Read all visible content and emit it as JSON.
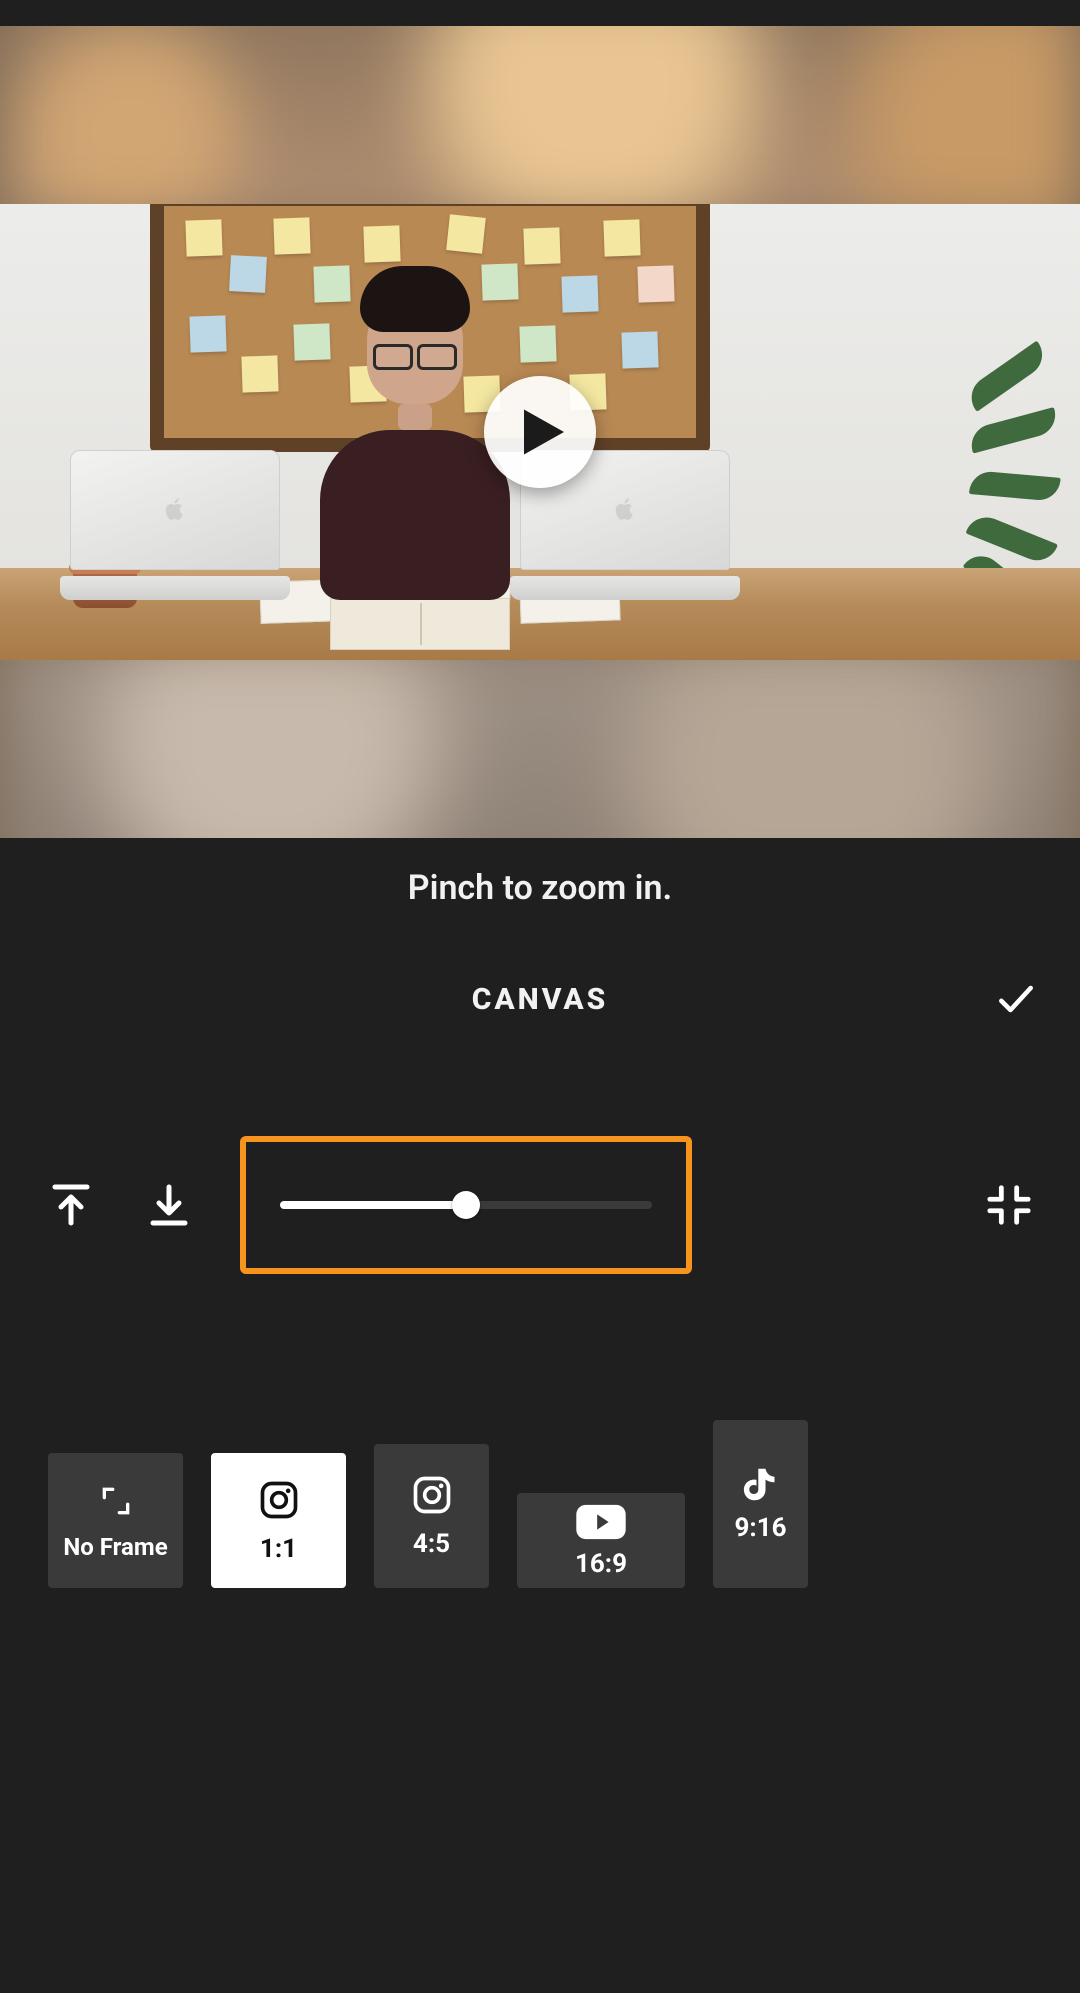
{
  "hint_text": "Pinch to zoom in.",
  "section_title": "CANVAS",
  "slider": {
    "percent": 50,
    "highlight_color": "#f7941d"
  },
  "icons": {
    "align_top": "align-top-icon",
    "align_bottom": "align-bottom-icon",
    "fit": "fit-screen-icon",
    "confirm": "checkmark-icon",
    "play": "play-icon"
  },
  "ratios": [
    {
      "id": "no-frame",
      "label": "No Frame",
      "icon": "expand-corners-icon",
      "selected": false,
      "shape": "noframe"
    },
    {
      "id": "1-1",
      "label": "1:1",
      "icon": "instagram-icon",
      "selected": true,
      "shape": "11"
    },
    {
      "id": "4-5",
      "label": "4:5",
      "icon": "instagram-icon",
      "selected": false,
      "shape": "45"
    },
    {
      "id": "16-9",
      "label": "16:9",
      "icon": "youtube-icon",
      "selected": false,
      "shape": "169"
    },
    {
      "id": "9-16",
      "label": "9:16",
      "icon": "tiktok-icon",
      "selected": false,
      "shape": "916"
    }
  ]
}
